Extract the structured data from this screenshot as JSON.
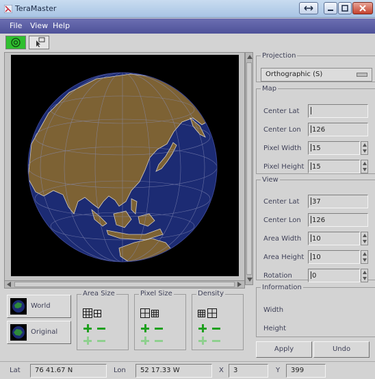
{
  "window": {
    "title": "TeraMaster"
  },
  "menu": {
    "file": "File",
    "view": "View",
    "help": "Help"
  },
  "toolbar": {
    "globe_icon": "globe-target-icon",
    "tool_icon": "pointer-tool-icon",
    "active_color": "#2fbf2f"
  },
  "projection": {
    "legend": "Projection",
    "selected": "Orthographic (S)"
  },
  "map_group": {
    "legend": "Map",
    "center_lat_label": "Center Lat",
    "center_lat_value": "",
    "center_lon_label": "Center Lon",
    "center_lon_value": "126",
    "pixel_width_label": "Pixel Width",
    "pixel_width_value": "15",
    "pixel_height_label": "Pixel Height",
    "pixel_height_value": "15"
  },
  "view_group": {
    "legend": "View",
    "center_lat_label": "Center Lat",
    "center_lat_value": "37",
    "center_lon_label": "Center Lon",
    "center_lon_value": "126",
    "area_width_label": "Area Width",
    "area_width_value": "10",
    "area_height_label": "Area Height",
    "area_height_value": "10",
    "rotation_label": "Rotation",
    "rotation_value": "0"
  },
  "information": {
    "legend": "Information",
    "width_label": "Width",
    "height_label": "Height"
  },
  "actions": {
    "apply": "Apply",
    "undo": "Undo"
  },
  "bottom": {
    "world_label": "World",
    "original_label": "Original",
    "area_size_label": "Area Size",
    "pixel_size_label": "Pixel Size",
    "density_label": "Density"
  },
  "status": {
    "lat_label": "Lat",
    "lat_value": "76 41.67 N",
    "lon_label": "Lon",
    "lon_value": "52 17.33 W",
    "x_label": "X",
    "x_value": "3",
    "y_label": "Y",
    "y_value": "399"
  },
  "colors": {
    "ocean": "#1c2b73",
    "land": "#7d6234",
    "coast": "#d8d0c0",
    "menubar": "#5b5fa6"
  }
}
